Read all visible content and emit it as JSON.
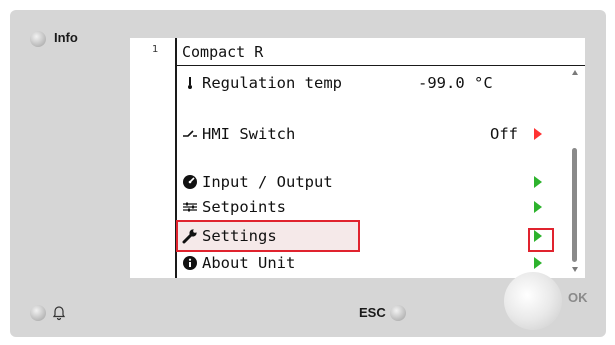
{
  "device": {
    "info_label": "Info",
    "esc_label": "ESC",
    "ok_label": "OK"
  },
  "screen": {
    "page_number": "1",
    "title": "Compact R",
    "rows": [
      {
        "icon": "thermometer-icon",
        "label": "Regulation temp",
        "value": "-99.0 °C"
      },
      {
        "icon": "switch-icon",
        "label": "HMI Switch",
        "value": "Off",
        "arrow": "red"
      },
      {
        "icon": "gauge-icon",
        "label": "Input / Output",
        "arrow": "green"
      },
      {
        "icon": "setpoints-icon",
        "label": "Setpoints",
        "arrow": "green"
      },
      {
        "icon": "wrench-icon",
        "label": "Settings",
        "arrow": "green",
        "highlighted": true
      },
      {
        "icon": "info-icon",
        "label": "About Unit",
        "arrow": "green"
      }
    ]
  },
  "colors": {
    "arrow_green": "#2db32d",
    "arrow_red": "#ff3333",
    "highlight_border": "#e0232e",
    "highlight_fill": "#f5e9e9"
  }
}
